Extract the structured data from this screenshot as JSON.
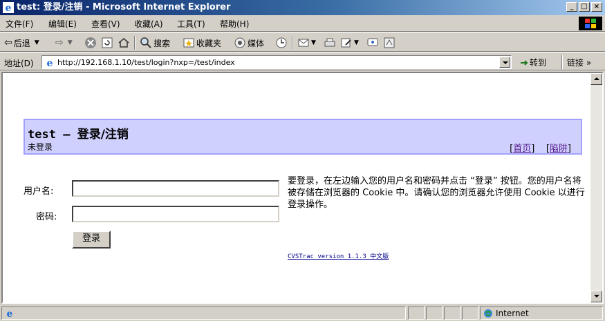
{
  "window": {
    "title": "test: 登录/注销 - Microsoft Internet Explorer",
    "buttons": {
      "minimize": "_",
      "maximize": "□",
      "close": "×"
    }
  },
  "menu": [
    "文件(F)",
    "编辑(E)",
    "查看(V)",
    "收藏(A)",
    "工具(T)",
    "帮助(H)"
  ],
  "toolbar": {
    "back": "后退",
    "search": "搜索",
    "favorites": "收藏夹",
    "media": "媒体"
  },
  "address": {
    "label": "地址(D)",
    "url": "http://192.168.1.10/test/login?nxp=/test/index",
    "go": "转到",
    "links": "链接 »"
  },
  "page": {
    "header": {
      "project": "test",
      "dash": "–",
      "title": "登录/注销",
      "status": "未登录",
      "links": [
        "首页",
        "陷阱"
      ]
    },
    "form": {
      "username_label": "用户名:",
      "password_label": "密码:",
      "username_value": "",
      "password_value": "",
      "submit": "登录"
    },
    "help": "要登录，在左边输入您的用户名和密码并点击 “登录” 按钮。您的用户名将被存储在浏览器的 Cookie 中。请确认您的浏览器允许使用 Cookie 以进行登录操作。",
    "version": "CVSTrac version 1.1.3 中文版"
  },
  "statusbar": {
    "zone": "Internet"
  }
}
